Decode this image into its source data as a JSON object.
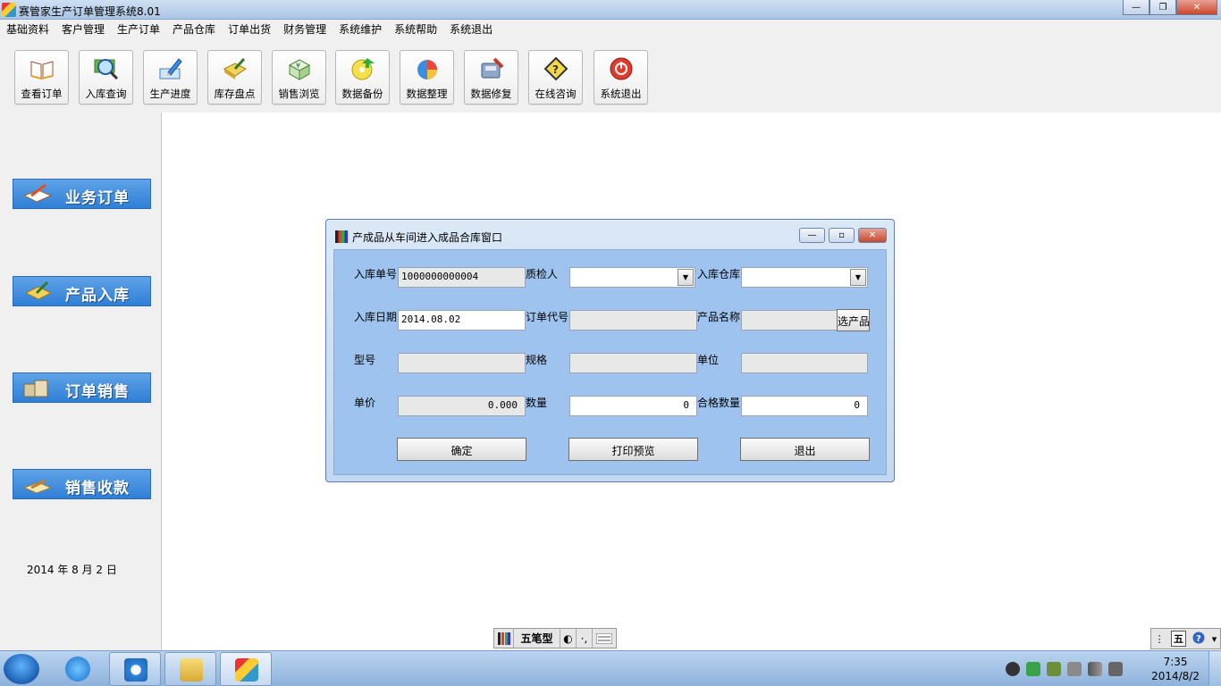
{
  "window": {
    "title": "赛管家生产订单管理系统8.01",
    "min_symbol": "—",
    "max_symbol": "❐",
    "close_symbol": "✕"
  },
  "menu": [
    "基础资料",
    "客户管理",
    "生产订单",
    "产品仓库",
    "订单出货",
    "财务管理",
    "系统维护",
    "系统帮助",
    "系统退出"
  ],
  "toolbar": [
    {
      "label": "查看订单",
      "icon": "book-icon"
    },
    {
      "label": "入库查询",
      "icon": "magnifier-icon"
    },
    {
      "label": "生产进度",
      "icon": "pencil-icon"
    },
    {
      "label": "库存盘点",
      "icon": "notebook-icon"
    },
    {
      "label": "销售浏览",
      "icon": "money-icon"
    },
    {
      "label": "数据备份",
      "icon": "backup-disc-icon"
    },
    {
      "label": "数据整理",
      "icon": "pie-chart-icon"
    },
    {
      "label": "数据修复",
      "icon": "repair-icon"
    },
    {
      "label": "在线咨询",
      "icon": "help-sign-icon"
    },
    {
      "label": "系统退出",
      "icon": "power-icon"
    }
  ],
  "sidebar": {
    "items": [
      {
        "label": "业务订单",
        "icon": "order-icon"
      },
      {
        "label": "产品入库",
        "icon": "stock-in-icon"
      },
      {
        "label": "订单销售",
        "icon": "boxes-icon"
      },
      {
        "label": "销售收款",
        "icon": "payment-icon"
      }
    ],
    "date": "2014 年   8 月  2 日"
  },
  "dialog": {
    "title": "产成品从车间进入成品合库窗口",
    "min_symbol": "—",
    "max_symbol": "▫",
    "close_symbol": "✕",
    "labels": {
      "receipt_no": "入库单号",
      "inspector": "质检人",
      "warehouse": "入库仓库",
      "receipt_date": "入库日期",
      "order_code": "订单代号",
      "product_name": "产品名称",
      "model": "型号",
      "spec": "规格",
      "unit": "单位",
      "unit_price": "单价",
      "quantity": "数量",
      "qualified_qty": "合格数量"
    },
    "values": {
      "receipt_no": "1000000000004",
      "inspector": "",
      "warehouse": "",
      "receipt_date": "2014.08.02",
      "order_code": "",
      "product_name": "",
      "model": "",
      "spec": "",
      "unit": "",
      "unit_price": "0.000",
      "quantity": "0",
      "qualified_qty": "0"
    },
    "pick_product_label": "选产品",
    "buttons": {
      "ok": "确定",
      "print_preview": "打印预览",
      "exit": "退出"
    }
  },
  "ime": {
    "mode": "五笔型",
    "moon": "◐",
    "punct": "·,",
    "right_label": "五"
  },
  "taskbar": {
    "time": "7:35",
    "date": "2014/8/2"
  }
}
